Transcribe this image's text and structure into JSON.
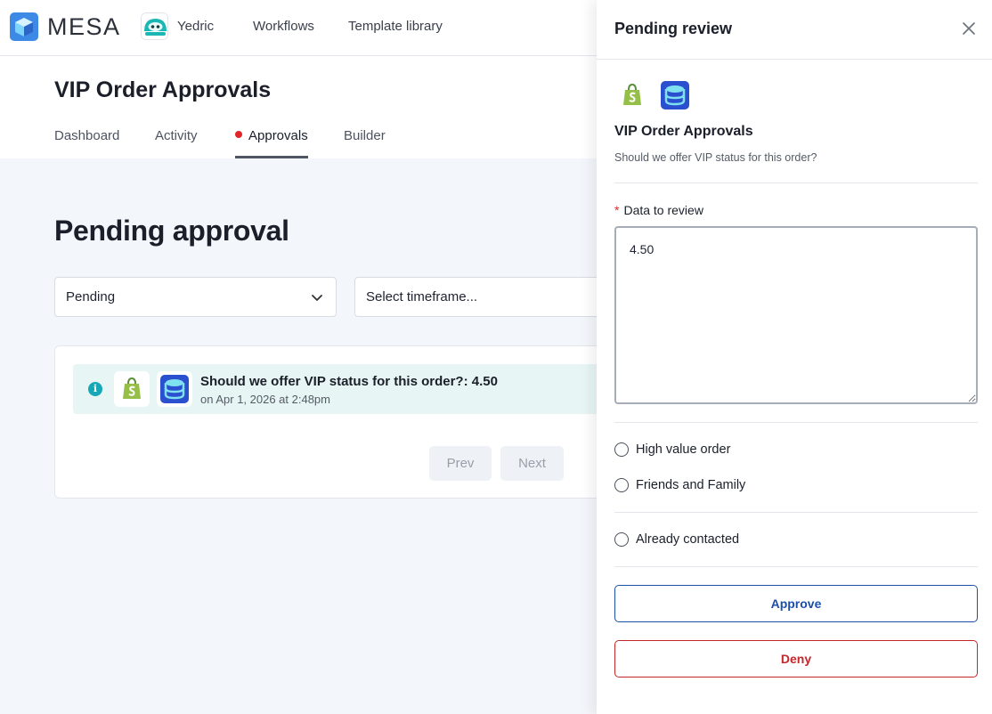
{
  "brand": {
    "name": "MESA"
  },
  "account": {
    "name": "Yedric"
  },
  "nav": {
    "links": [
      "Workflows",
      "Template library"
    ]
  },
  "workflow": {
    "title": "VIP Order Approvals",
    "tabs": [
      "Dashboard",
      "Activity",
      "Approvals",
      "Builder"
    ],
    "active_tab": "Approvals"
  },
  "main": {
    "section_title": "Pending approval",
    "status_filter": {
      "value": "Pending"
    },
    "timeframe_filter": {
      "placeholder": "Select timeframe..."
    },
    "approvals": [
      {
        "title": "Should we offer VIP status for this order?: 4.50",
        "timestamp": "on Apr 1, 2026 at 2:48pm",
        "apps": [
          "shopify-icon",
          "database-icon"
        ]
      }
    ],
    "pager": {
      "prev_label": "Prev",
      "next_label": "Next"
    }
  },
  "drawer": {
    "title": "Pending review",
    "apps": [
      "shopify-icon",
      "database-icon"
    ],
    "workflow_name": "VIP Order Approvals",
    "description": "Should we offer VIP status for this order?",
    "field": {
      "required_mark": "*",
      "label": "Data to review",
      "value": "4.50"
    },
    "options_group_1": [
      "High value order",
      "Friends and Family"
    ],
    "options_group_2": [
      "Already contacted"
    ],
    "approve_label": "Approve",
    "deny_label": "Deny"
  },
  "colors": {
    "accent_blue": "#1c4fa8",
    "deny_red": "#c3262b",
    "alert_dot": "#e0262b",
    "row_highlight": "#e7f6f4",
    "info_teal": "#17a8b8"
  }
}
